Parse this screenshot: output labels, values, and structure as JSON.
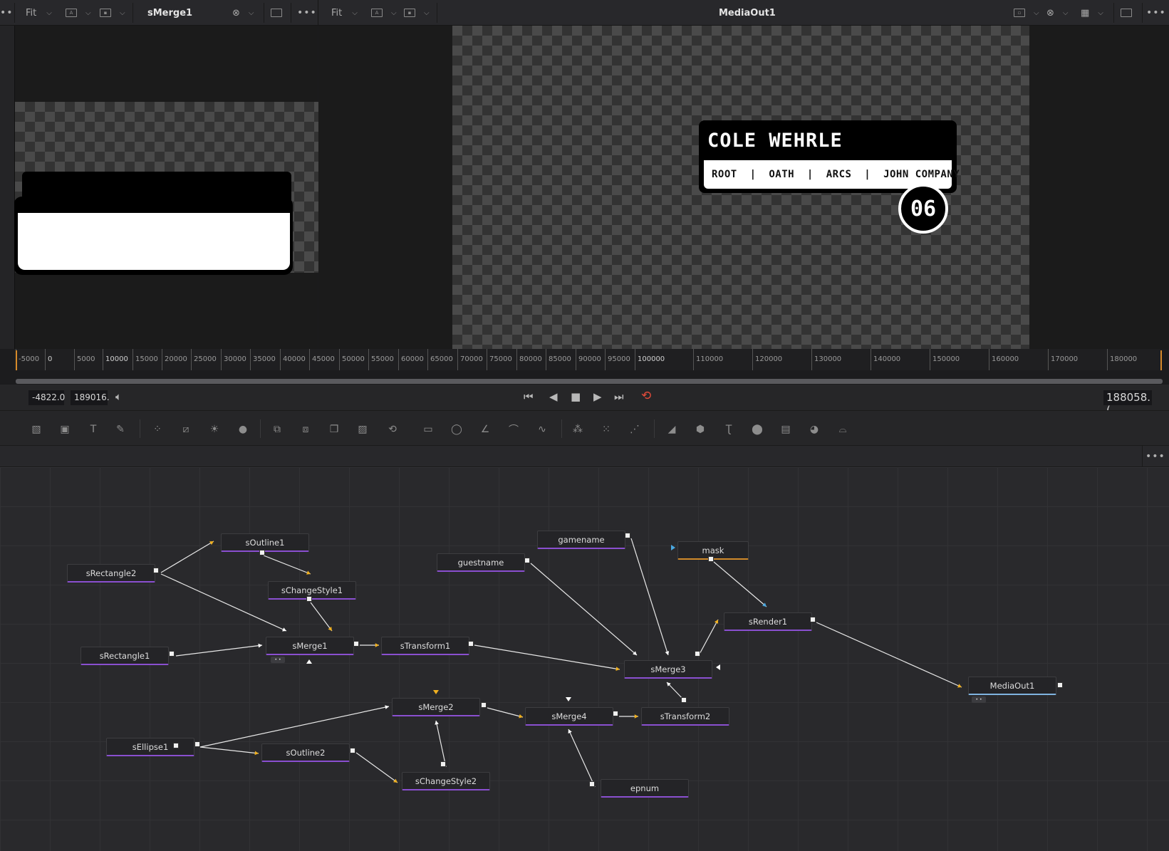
{
  "left_viewer": {
    "fit": "Fit",
    "title": "sMerge1"
  },
  "right_viewer": {
    "fit": "Fit",
    "title": "MediaOut1"
  },
  "lower_third": {
    "name": "COLE WEHRLE",
    "games": "ROOT  |  OATH  |  ARCS  |  JOHN COMPANY",
    "episode": "06"
  },
  "ruler": {
    "ticks": [
      "-5000",
      "0",
      "5000",
      "10000",
      "15000",
      "20000",
      "25000",
      "30000",
      "35000",
      "40000",
      "45000",
      "50000",
      "55000",
      "60000",
      "65000",
      "70000",
      "75000",
      "80000",
      "85000",
      "90000",
      "95000",
      "100000",
      "110000",
      "120000",
      "130000",
      "140000",
      "150000",
      "160000",
      "170000",
      "180000"
    ]
  },
  "transport": {
    "start_time": "-4822.0",
    "end_time": "189016.",
    "current_time": "188058.("
  },
  "icons": {
    "tool_icons": [
      "background-icon",
      "image-icon",
      "text-icon",
      "paint-icon",
      "particles-icon",
      "color-curves-icon",
      "brightness-icon",
      "blur-drop-icon",
      "merge-icon",
      "channel-booleans-icon",
      "matte-control-icon",
      "loader-icon",
      "transform-icon",
      "crop-icon",
      "ellipse-mask-icon",
      "polygon-mask-icon",
      "bspline-mask-icon",
      "wave-icon",
      "particle-emitter-icon",
      "particle-render-icon",
      "particle-style-icon",
      "image-plane-3d-icon",
      "shape-3d-icon",
      "text-3d-icon",
      "merge-3d-icon",
      "renderer-3d-icon",
      "light-3d-icon",
      "camera-3d-icon"
    ]
  },
  "nodes": [
    {
      "id": "sOutline1",
      "label": "sOutline1",
      "color": "purple"
    },
    {
      "id": "sRectangle2",
      "label": "sRectangle2",
      "color": "purple"
    },
    {
      "id": "sChangeStyle1",
      "label": "sChangeStyle1",
      "color": "purple"
    },
    {
      "id": "sRectangle1",
      "label": "sRectangle1",
      "color": "purple"
    },
    {
      "id": "sMerge1",
      "label": "sMerge1",
      "color": "purple"
    },
    {
      "id": "sTransform1",
      "label": "sTransform1",
      "color": "purple"
    },
    {
      "id": "gamename",
      "label": "gamename",
      "color": "purple"
    },
    {
      "id": "guestname",
      "label": "guestname",
      "color": "purple"
    },
    {
      "id": "mask",
      "label": "mask",
      "color": "orange"
    },
    {
      "id": "sRender1",
      "label": "sRender1",
      "color": "purple"
    },
    {
      "id": "sMerge3",
      "label": "sMerge3",
      "color": "purple"
    },
    {
      "id": "MediaOut1",
      "label": "MediaOut1",
      "color": "blue"
    },
    {
      "id": "sMerge2",
      "label": "sMerge2",
      "color": "purple"
    },
    {
      "id": "sMerge4",
      "label": "sMerge4",
      "color": "purple"
    },
    {
      "id": "sTransform2",
      "label": "sTransform2",
      "color": "purple"
    },
    {
      "id": "sEllipse1",
      "label": "sEllipse1",
      "color": "purple"
    },
    {
      "id": "sOutline2",
      "label": "sOutline2",
      "color": "purple"
    },
    {
      "id": "sChangeStyle2",
      "label": "sChangeStyle2",
      "color": "purple"
    },
    {
      "id": "epnum",
      "label": "epnum",
      "color": "purple"
    }
  ]
}
